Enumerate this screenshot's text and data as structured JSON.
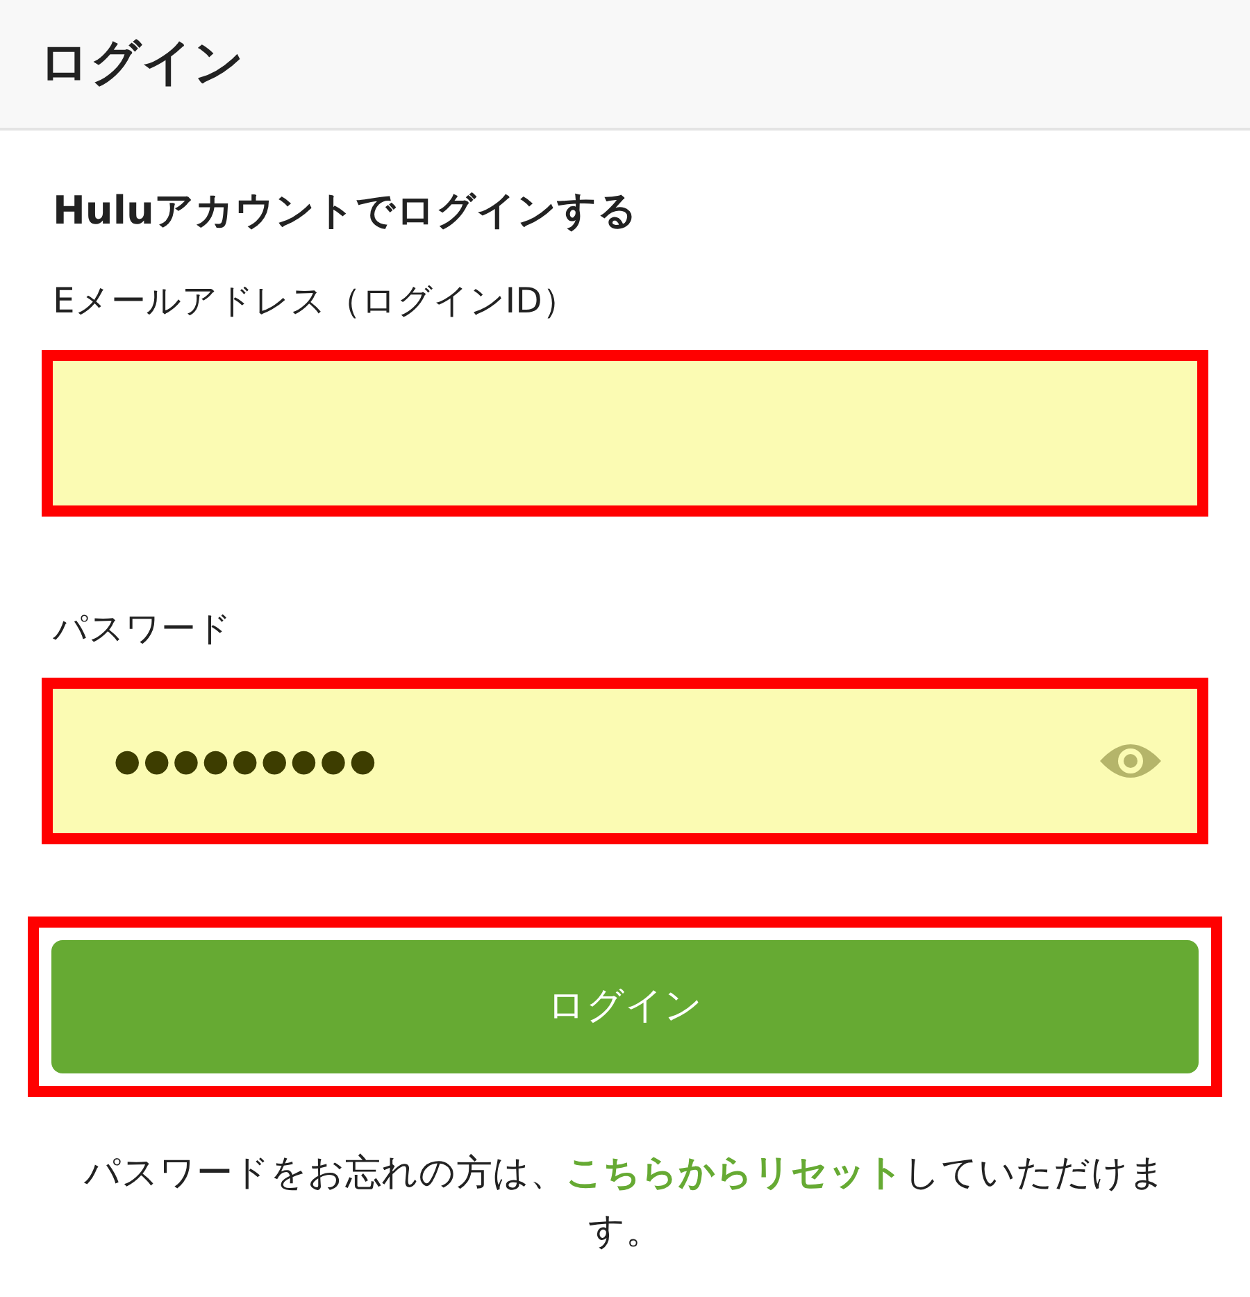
{
  "header": {
    "title": "ログイン"
  },
  "heading": "Huluアカウントでログインする",
  "fields": [
    {
      "kind": "text",
      "label": "Eメールアドレス（ログインID）",
      "highlighted": true
    },
    {
      "kind": "password",
      "label": "パスワード",
      "value": "●●●●●●●●●",
      "highlighted": true
    }
  ],
  "login_button": {
    "label": "ログイン",
    "highlighted": true
  },
  "reset_note": {
    "before": "パスワードをお忘れの方は、",
    "link": "こちらからリセット",
    "after": "していただけます。"
  }
}
